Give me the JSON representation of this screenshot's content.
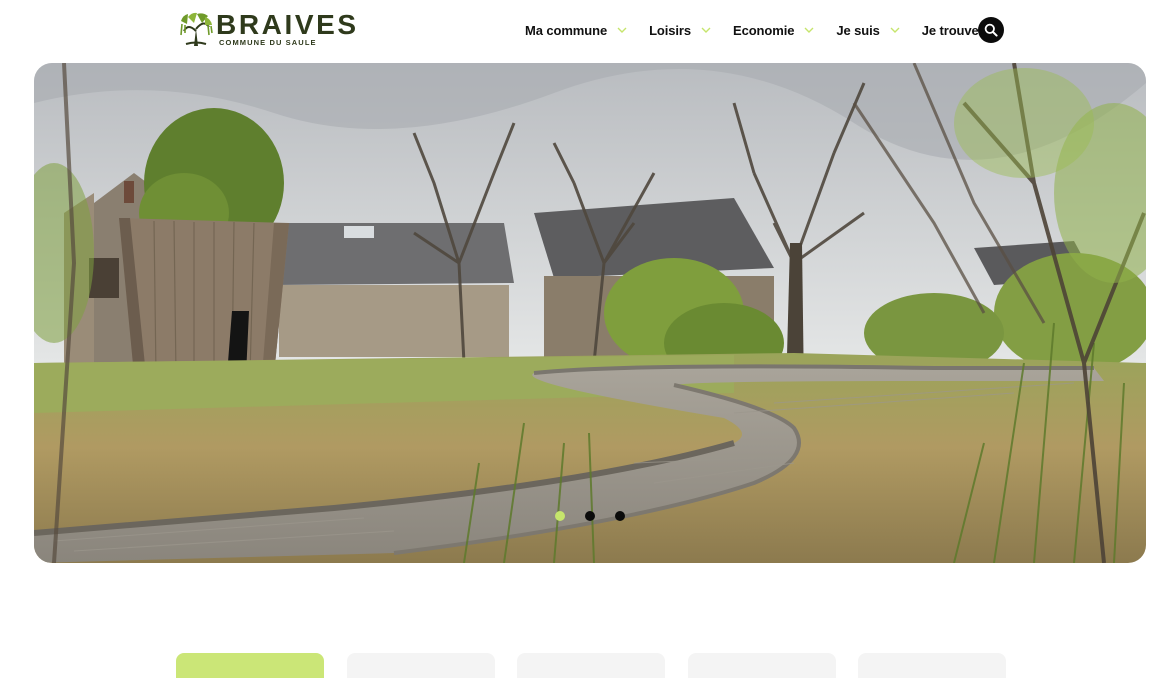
{
  "header": {
    "logo": {
      "name": "BRAIVES",
      "tagline": "COMMUNE DU SAULE",
      "icon": "willow-tree-icon"
    },
    "nav": [
      {
        "label": "Ma commune",
        "icon": "chevron-down-icon"
      },
      {
        "label": "Loisirs",
        "icon": "chevron-down-icon"
      },
      {
        "label": "Economie",
        "icon": "chevron-down-icon"
      },
      {
        "label": "Je suis",
        "icon": "chevron-down-icon"
      },
      {
        "label": "Je trouve",
        "icon": "chevron-down-icon"
      }
    ],
    "search": {
      "icon": "search-icon"
    }
  },
  "hero": {
    "image": "park-boardwalk-photo",
    "slides": {
      "count": 3,
      "active": 1
    }
  },
  "tiles": {
    "count": 5,
    "active": 1
  },
  "colors": {
    "accent": "#c6e56c",
    "logo": "#2f3a1c",
    "dark": "#0b0b0b",
    "tile": "#f4f4f4",
    "tile_active": "#cbe677"
  }
}
